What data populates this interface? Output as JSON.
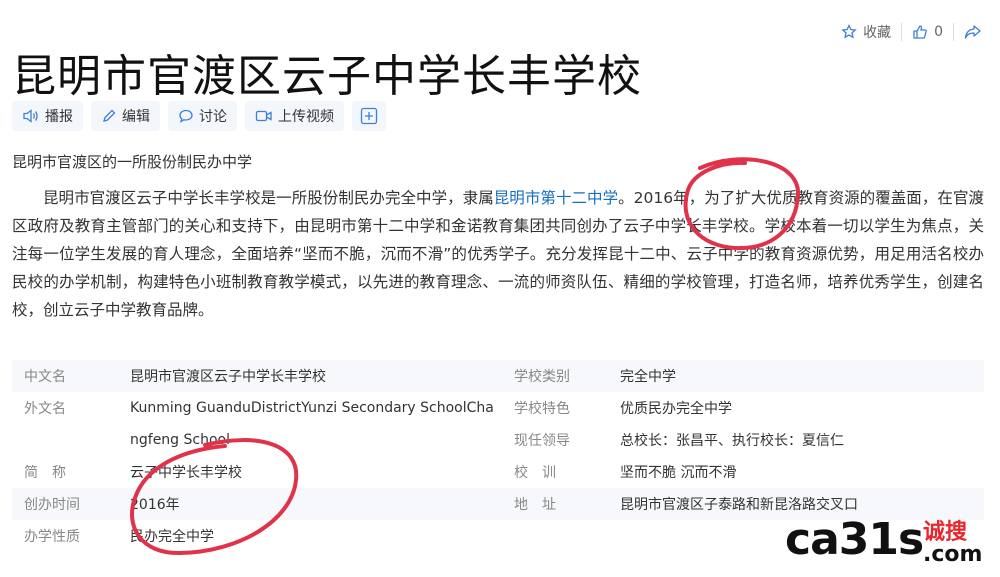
{
  "topbar": {
    "favorite_label": "收藏",
    "like_count": "0"
  },
  "title": "昆明市官渡区云子中学长丰学校",
  "actions": {
    "read": "播报",
    "edit": "编辑",
    "discuss": "讨论",
    "upload_video": "上传视频"
  },
  "summary": "昆明市官渡区的一所股份制民办中学",
  "paragraph": {
    "part1": "昆明市官渡区云子中学长丰学校是一所股份制民办完全中学，隶属",
    "link": "昆明市第十二中学",
    "part2": "。2016年，为了扩大优质教育资源的覆盖面，在官渡区政府及教育主管部门的关心和支持下，由昆明市第十二中学和金诺教育集团共同创办了云子中学长丰学校。学校本着一切以学生为焦点，关注每一位学生发展的育人理念，全面培养“坚而不脆，沉而不滑”的优秀学子。充分发挥昆十二中、云子中学的教育资源优势，用足用活名校办民校的办学机制，构建特色小班制教育教学模式，以先进的教育理念、一流的师资队伍、精细的学校管理，打造名师，培养优秀学生，创建名校，创立云子中学教育品牌。"
  },
  "info_left": [
    {
      "label": "中文名",
      "value": "昆明市官渡区云子中学长丰学校"
    },
    {
      "label": "外文名",
      "value": "Kunming GuanduDistrictYunzi Secondary SchoolCha"
    },
    {
      "label": "",
      "value": "ngfeng School"
    },
    {
      "label": "简　称",
      "value": "云子中学长丰学校"
    },
    {
      "label": "创办时间",
      "value": "2016年"
    },
    {
      "label": "办学性质",
      "value": "民办完全中学"
    }
  ],
  "info_right": [
    {
      "label": "学校类别",
      "value": "完全中学"
    },
    {
      "label": "学校特色",
      "value": "优质民办完全中学"
    },
    {
      "label": "现任领导",
      "value": "总校长：张昌平、执行校长：夏信仁"
    },
    {
      "label": "校　训",
      "value": "坚而不脆 沉而不滑"
    },
    {
      "label": "地　址",
      "value": "昆明市官渡区子泰路和新昆洛路交叉口"
    }
  ],
  "watermark": {
    "brand": "ca31s",
    "cn": "诚搜",
    "domain": ".com"
  },
  "colors": {
    "link": "#136ec2",
    "annotation": "#e0334a",
    "icon": "#3d7fd9"
  }
}
